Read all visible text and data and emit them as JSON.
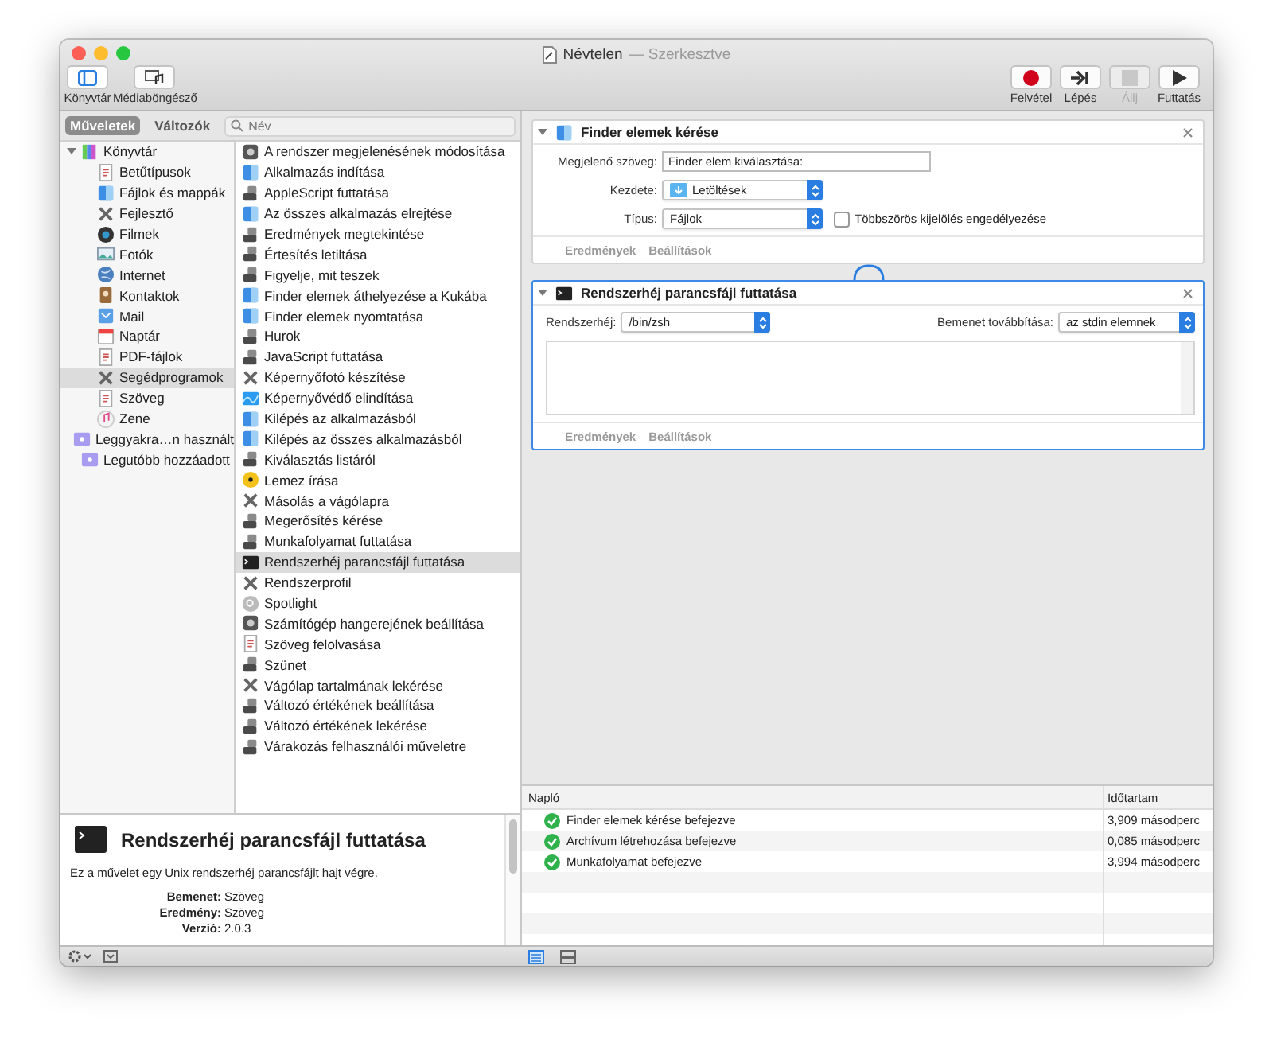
{
  "window": {
    "title": "Névtelen",
    "status": "— Szerkesztve"
  },
  "toolbar": {
    "left": [
      {
        "label": "Könyvtár",
        "selected": true
      },
      {
        "label": "Médiaböngésző",
        "selected": false
      }
    ],
    "right": [
      {
        "label": "Felvétel",
        "disabled": false
      },
      {
        "label": "Lépés",
        "disabled": false
      },
      {
        "label": "Állj",
        "disabled": true
      },
      {
        "label": "Futtatás",
        "disabled": false
      }
    ]
  },
  "sidebar": {
    "tabs": [
      {
        "label": "Műveletek",
        "selected": true
      },
      {
        "label": "Változók",
        "selected": false
      }
    ],
    "search": {
      "placeholder": "Név"
    },
    "library": [
      {
        "label": "Könyvtár",
        "expanded": true,
        "selected": false,
        "children": [
          {
            "label": "Betűtípusok",
            "selected": false
          },
          {
            "label": "Fájlok és mappák",
            "selected": false
          },
          {
            "label": "Fejlesztő",
            "selected": false
          },
          {
            "label": "Filmek",
            "selected": false
          },
          {
            "label": "Fotók",
            "selected": false
          },
          {
            "label": "Internet",
            "selected": false
          },
          {
            "label": "Kontaktok",
            "selected": false
          },
          {
            "label": "Mail",
            "selected": false
          },
          {
            "label": "Naptár",
            "selected": false
          },
          {
            "label": "PDF-fájlok",
            "selected": false
          },
          {
            "label": "Segédprogramok",
            "selected": true
          },
          {
            "label": "Szöveg",
            "selected": false
          },
          {
            "label": "Zene",
            "selected": false
          }
        ]
      },
      {
        "label": "Leggyakra…n használt",
        "selected": false
      },
      {
        "label": "Legutóbb hozzáadott",
        "selected": false
      }
    ],
    "actions": [
      {
        "label": "A rendszer megjelenésének módosítása",
        "selected": false
      },
      {
        "label": "Alkalmazás indítása",
        "selected": false
      },
      {
        "label": "AppleScript futtatása",
        "selected": false
      },
      {
        "label": "Az összes alkalmazás elrejtése",
        "selected": false
      },
      {
        "label": "Eredmények megtekintése",
        "selected": false
      },
      {
        "label": "Értesítés letiltása",
        "selected": false
      },
      {
        "label": "Figyelje, mit teszek",
        "selected": false
      },
      {
        "label": "Finder elemek áthelyezése a Kukába",
        "selected": false
      },
      {
        "label": "Finder elemek nyomtatása",
        "selected": false
      },
      {
        "label": "Hurok",
        "selected": false
      },
      {
        "label": "JavaScript futtatása",
        "selected": false
      },
      {
        "label": "Képernyőfotó készítése",
        "selected": false
      },
      {
        "label": "Képernyővédő elindítása",
        "selected": false
      },
      {
        "label": "Kilépés az alkalmazásból",
        "selected": false
      },
      {
        "label": "Kilépés az összes alkalmazásból",
        "selected": false
      },
      {
        "label": "Kiválasztás listáról",
        "selected": false
      },
      {
        "label": "Lemez írása",
        "selected": false
      },
      {
        "label": "Másolás a vágólapra",
        "selected": false
      },
      {
        "label": "Megerősítés kérése",
        "selected": false
      },
      {
        "label": "Munkafolyamat futtatása",
        "selected": false
      },
      {
        "label": "Rendszerhéj parancsfájl futtatása",
        "selected": true
      },
      {
        "label": "Rendszerprofil",
        "selected": false
      },
      {
        "label": "Spotlight",
        "selected": false
      },
      {
        "label": "Számítógép hangerejének beállítása",
        "selected": false
      },
      {
        "label": "Szöveg felolvasása",
        "selected": false
      },
      {
        "label": "Szünet",
        "selected": false
      },
      {
        "label": "Vágólap tartalmának lekérése",
        "selected": false
      },
      {
        "label": "Változó értékének beállítása",
        "selected": false
      },
      {
        "label": "Változó értékének lekérése",
        "selected": false
      },
      {
        "label": "Várakozás felhasználói műveletre",
        "selected": false
      }
    ],
    "description": {
      "title": "Rendszerhéj parancsfájl futtatása",
      "text": "Ez a művelet egy Unix rendszerhéj parancsfájlt hajt végre.",
      "details": [
        {
          "label": "Bemenet:",
          "value": "Szöveg"
        },
        {
          "label": "Eredmény:",
          "value": "Szöveg"
        },
        {
          "label": "Verzió:",
          "value": "2.0.3"
        }
      ]
    }
  },
  "workflow": [
    {
      "title": "Finder elemek kérése",
      "selected": false,
      "kind": "finder",
      "prompt": {
        "label": "Megjelenő szöveg:",
        "value": "Finder elem kiválasztása:"
      },
      "start": {
        "label": "Kezdete:",
        "value": "Letöltések"
      },
      "type": {
        "label": "Típus:",
        "value": "Fájlok"
      },
      "multiple": {
        "label": "Többszörös kijelölés engedélyezése",
        "checked": false
      },
      "footer": [
        "Eredmények",
        "Beállítások"
      ]
    },
    {
      "title": "Rendszerhéj parancsfájl futtatása",
      "selected": true,
      "kind": "shell",
      "shell": {
        "label": "Rendszerhéj:",
        "value": "/bin/zsh"
      },
      "input": {
        "label": "Bemenet továbbítása:",
        "value": "az stdin elemnek"
      },
      "footer": [
        "Eredmények",
        "Beállítások"
      ]
    }
  ],
  "log": {
    "columns": [
      "Napló",
      "Időtartam"
    ],
    "rows": [
      {
        "message": "Finder elemek kérése befejezve",
        "duration": "3,909 másodperc",
        "ok": true
      },
      {
        "message": "Archívum létrehozása befejezve",
        "duration": "0,085 másodperc",
        "ok": true
      },
      {
        "message": "Munkafolyamat befejezve",
        "duration": "3,994 másodperc",
        "ok": true
      }
    ]
  }
}
